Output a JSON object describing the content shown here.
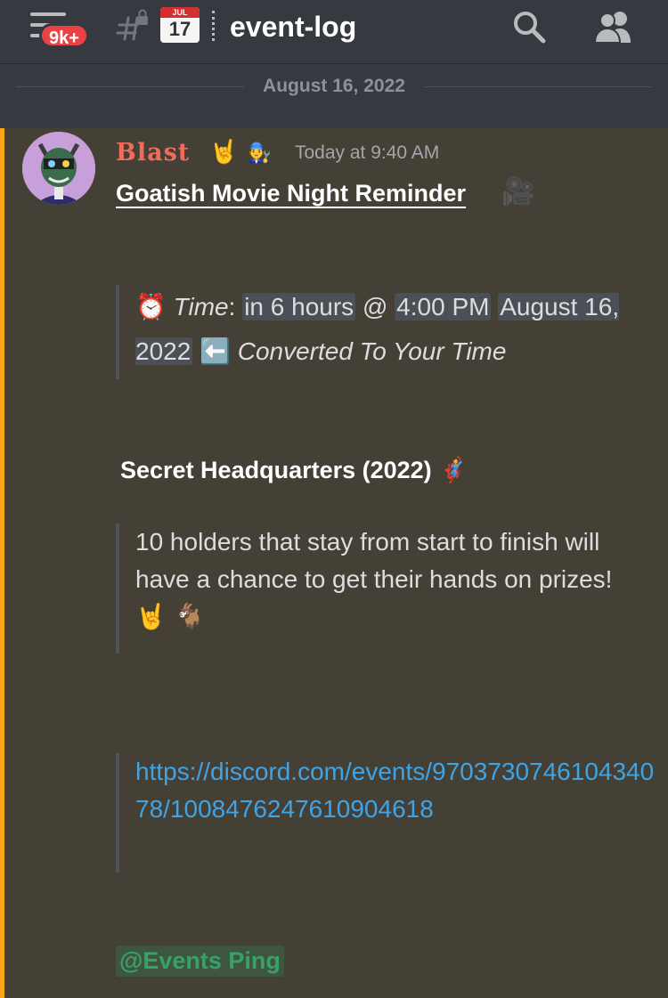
{
  "header": {
    "notification_badge": "9k+",
    "channel_name": "event-log",
    "calendar_month": "JUL",
    "calendar_day": "17"
  },
  "date_divider": "August 16, 2022",
  "message": {
    "username": "Blast",
    "username_emoji": "🤘",
    "role_emoji": "🧑‍🔧",
    "timestamp": "Today at 9:40 AM",
    "title": "Goatish Movie Night Reminder",
    "title_emoji": "🎥",
    "time_quote": {
      "alarm_emoji": "⏰",
      "time_label": "Time",
      "colon": ":",
      "relative": "in 6 hours",
      "at": "@",
      "clock": "4:00 PM",
      "date": "August 16, 2022",
      "arrow_emoji": "⬅️",
      "converted": "Converted To Your Time"
    },
    "section_title": "Secret Headquarters (2022)",
    "section_emoji": "🦸",
    "description": " 10 holders that stay from start to finish will have a chance to get their hands on prizes!",
    "description_emojis": "🤘 🐐",
    "event_link": "https://discord.com/events/970373074610434078/1008476247610904618",
    "role_mention": "@Events Ping"
  },
  "colors": {
    "accent_bar": "#faa81a",
    "link": "#3ea4e6",
    "username": "#ef6b5b",
    "badge": "#ed4245"
  }
}
